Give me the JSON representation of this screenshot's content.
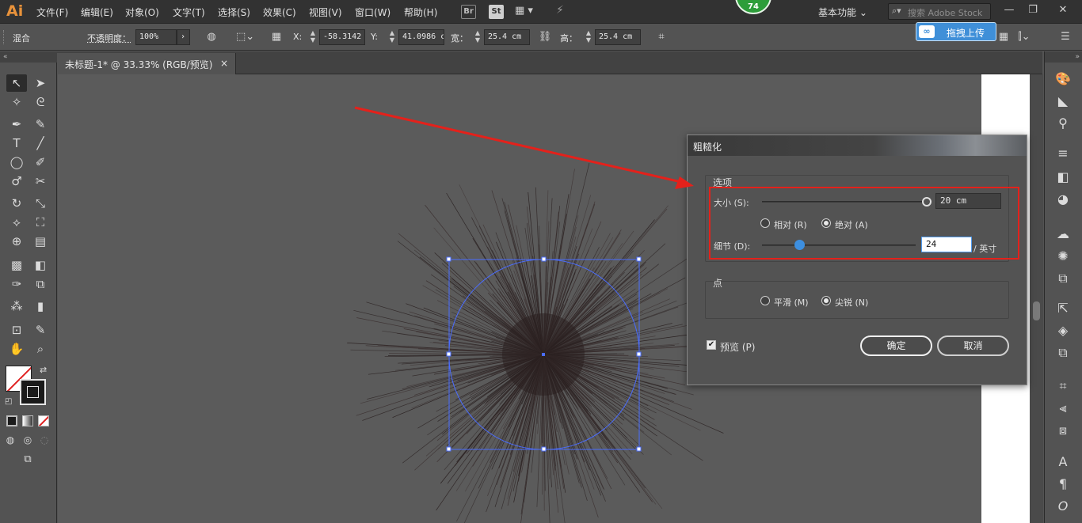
{
  "app": {
    "logo": "Ai",
    "menus": [
      "文件(F)",
      "编辑(E)",
      "对象(O)",
      "文字(T)",
      "选择(S)",
      "效果(C)",
      "视图(V)",
      "窗口(W)",
      "帮助(H)"
    ],
    "bridge_label": "Br",
    "stock_label": "St",
    "badge_count": "74",
    "workspace_label": "基本功能",
    "search_placeholder": "搜索 Adobe Stock"
  },
  "control_bar": {
    "mode_label": "混合",
    "opacity_label": "不透明度：",
    "opacity_value": "100%",
    "x_label": "X:",
    "x_value": "-58.3142",
    "y_label": "Y:",
    "y_value": "41.0986 c",
    "width_label": "宽：",
    "width_value": "25.4 cm",
    "height_label": "高：",
    "height_value": "25.4 cm",
    "upload_label": "拖拽上传"
  },
  "document_tab": {
    "title": "未标题-1* @ 33.33% (RGB/预览)",
    "close": "×"
  },
  "dialog": {
    "title": "粗糙化",
    "options_group": "选项",
    "size_label": "大小 (S):",
    "size_value": "20 cm",
    "relative_label": "相对 (R)",
    "absolute_label": "绝对 (A)",
    "absolute_selected": true,
    "detail_label": "细节 (D):",
    "detail_value": "24",
    "detail_unit": "/ 英寸",
    "points_group": "点",
    "smooth_label": "平滑 (M)",
    "sharp_label": "尖锐 (N)",
    "sharp_selected": true,
    "preview_label": "预览 (P)",
    "preview_checked": true,
    "ok_label": "确定",
    "cancel_label": "取消"
  },
  "colors": {
    "accent": "#3f8fd8",
    "annotation": "#e4211b",
    "selection": "#4a6cff"
  }
}
